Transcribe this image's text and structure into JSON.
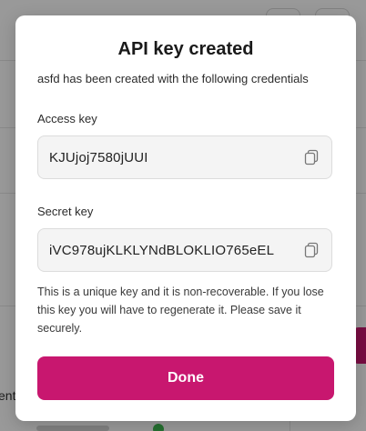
{
  "background": {
    "partial_text": "ent"
  },
  "modal": {
    "title": "API key created",
    "subtitle": "asfd has been created with the following credentials",
    "access_key": {
      "label": "Access key",
      "value": "KJUjoj7580jUUI",
      "copy_icon": "copy-icon"
    },
    "secret_key": {
      "label": "Secret key",
      "value": "iVC978ujKLKLYNdBLOKLIO765eEL",
      "copy_icon": "copy-icon"
    },
    "note": "This is a unique key and it is non-recoverable. If you lose this key you will have to regenerate it. Please save it securely.",
    "done_label": "Done"
  },
  "colors": {
    "accent": "#c8176f",
    "overlay": "rgba(0,0,0,0.40)",
    "field_bg": "#f4f4f4"
  }
}
